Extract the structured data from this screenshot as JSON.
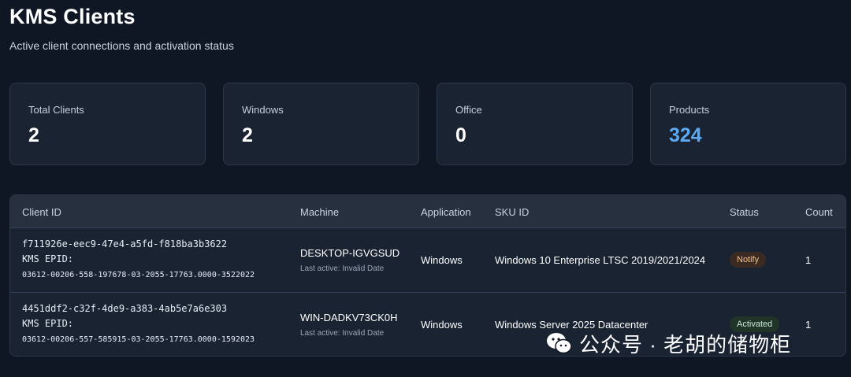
{
  "header": {
    "title": "KMS Clients",
    "subtitle": "Active client connections and activation status"
  },
  "stats": [
    {
      "label": "Total Clients",
      "value": "2"
    },
    {
      "label": "Windows",
      "value": "2"
    },
    {
      "label": "Office",
      "value": "0"
    },
    {
      "label": "Products",
      "value": "324"
    }
  ],
  "colors": {
    "background": "#0f1624",
    "card": "#1a2332",
    "accent": "#5aa9f2",
    "notify": "#f2c28a",
    "activated": "#c9e8d3"
  },
  "table": {
    "columns": [
      "Client ID",
      "Machine",
      "Application",
      "SKU ID",
      "Status",
      "Count"
    ],
    "rows": [
      {
        "client_id": "f711926e-eec9-47e4-a5fd-f818ba3b3622",
        "epid_label": "KMS EPID:",
        "epid": "03612-00206-558-197678-03-2055-17763.0000-3522022",
        "machine": "DESKTOP-IGVGSUD",
        "last_active": "Last active: Invalid Date",
        "application": "Windows",
        "sku": "Windows 10 Enterprise LTSC 2019/2021/2024",
        "status": "Notify",
        "count": "1"
      },
      {
        "client_id": "4451ddf2-c32f-4de9-a383-4ab5e7a6e303",
        "epid_label": "KMS EPID:",
        "epid": "03612-00206-557-585915-03-2055-17763.0000-1592023",
        "machine": "WIN-DADKV73CK0H",
        "last_active": "Last active: Invalid Date",
        "application": "Windows",
        "sku": "Windows Server 2025 Datacenter",
        "status": "Activated",
        "count": "1"
      }
    ]
  },
  "watermark": {
    "icon": "wechat-icon",
    "text": "公众号 · 老胡的储物柜"
  }
}
